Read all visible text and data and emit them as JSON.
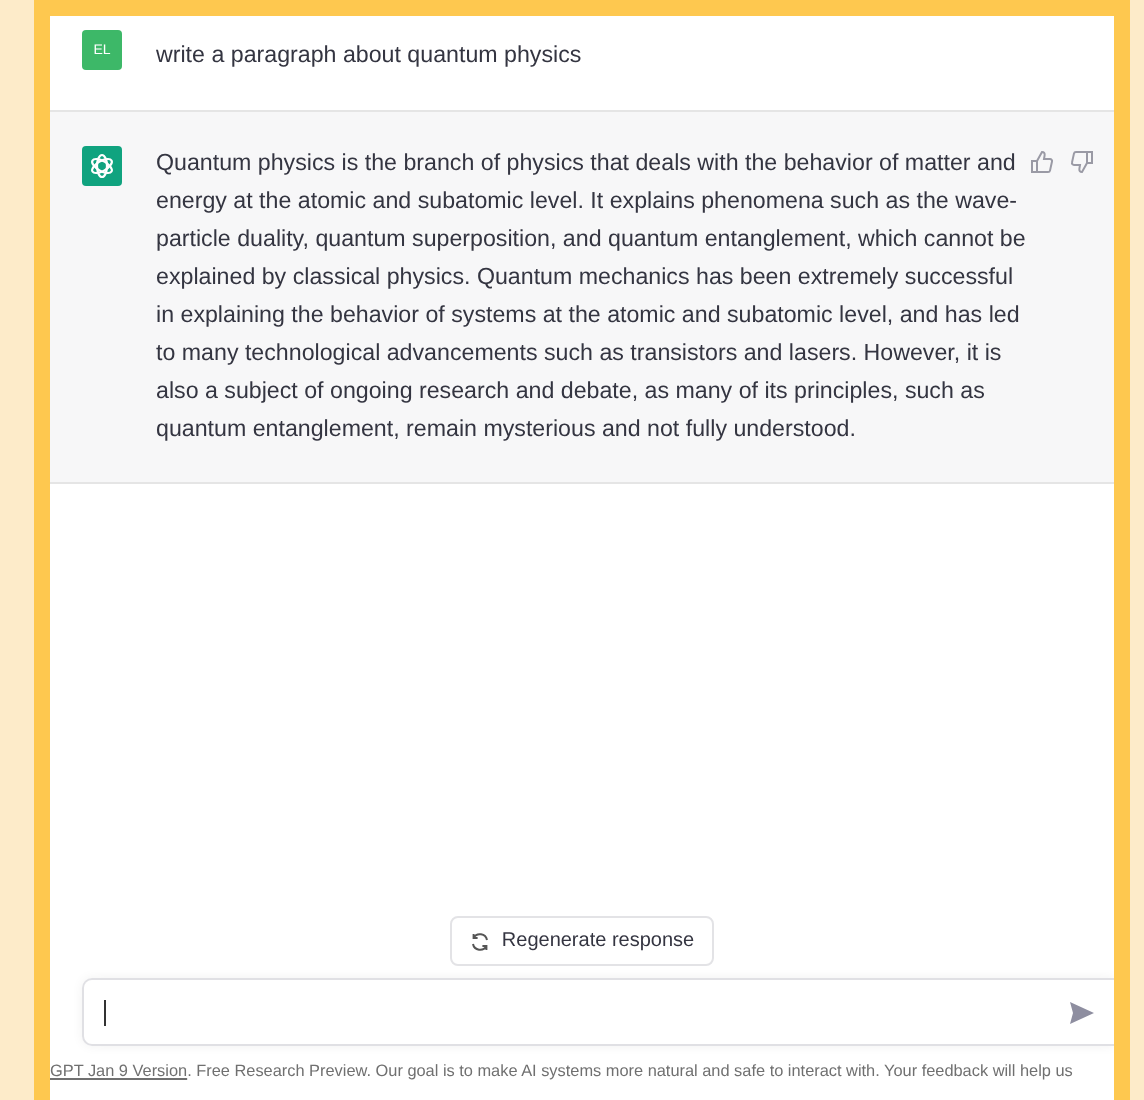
{
  "messages": [
    {
      "kind": "user",
      "avatar": "EL",
      "text": "write a paragraph about quantum physics"
    },
    {
      "kind": "assistant",
      "text": "Quantum physics is the branch of physics that deals with the behavior of matter and energy at the atomic and subatomic level. It explains phenomena such as the wave-particle duality, quantum superposition, and quantum entanglement, which cannot be explained by classical physics. Quantum mechanics has been extremely successful in explaining the behavior of systems at the atomic and subatomic level, and has led to many technological advancements such as transistors and lasers. However, it is also a subject of ongoing research and debate, as many of its principles, such as quantum entanglement, remain mysterious and not fully understood."
    }
  ],
  "regenerate_button": "Regenerate response",
  "footer": {
    "link": "GPT Jan 9 Version",
    "text": ". Free Research Preview. Our goal is to make AI systems more natural and safe to interact with. Your feedback will help us"
  }
}
